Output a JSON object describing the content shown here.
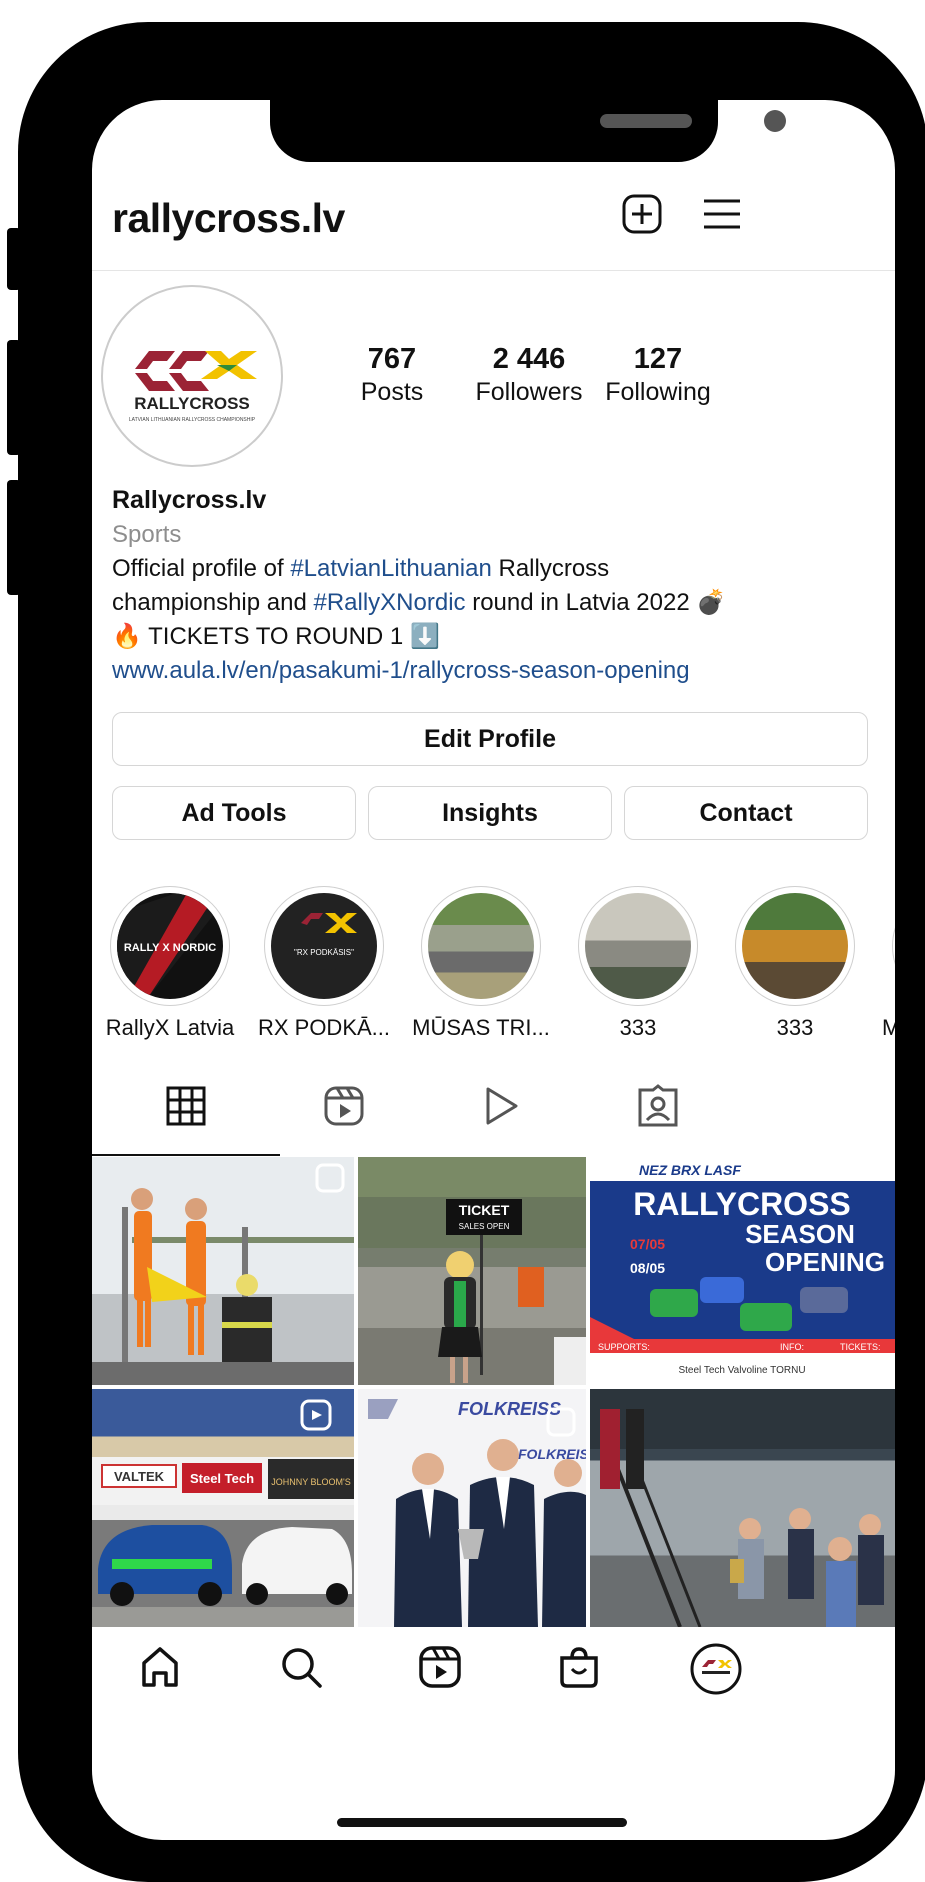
{
  "header": {
    "username": "rallycross.lv",
    "add_icon": "plus-square-icon",
    "menu_icon": "hamburger-icon"
  },
  "avatar": {
    "logo_text": "RALLYCROSS",
    "logo_sub": "LATVIAN LITHUANIAN RALLYCROSS CHAMPIONSHIP"
  },
  "stats": [
    {
      "value": "767",
      "label": "Posts"
    },
    {
      "value": "2 446",
      "label": "Followers"
    },
    {
      "value": "127",
      "label": "Following"
    }
  ],
  "bio": {
    "name": "Rallycross.lv",
    "category": "Sports",
    "line1_pre": "Official profile of ",
    "line1_tag": "#LatvianLithuanian",
    "line1_post": " Rallycross",
    "line2_pre": "championship and ",
    "line2_tag": "#RallyXNordic",
    "line2_post": " round in Latvia 2022 💣",
    "line3": "🔥 TICKETS TO ROUND 1 ⬇️",
    "link": "www.aula.lv/en/pasakumi-1/rallycross-season-opening"
  },
  "buttons": {
    "edit_profile": "Edit Profile",
    "ad_tools": "Ad Tools",
    "insights": "Insights",
    "contact": "Contact"
  },
  "highlights": [
    {
      "label": "RallyX Latvia",
      "cover_text": "RALLY X NORDIC"
    },
    {
      "label": "RX PODKĀ...",
      "cover_text": "\"RX PODKĀSIS\""
    },
    {
      "label": "MŪSAS TRI...",
      "cover_text": ""
    },
    {
      "label": "333",
      "cover_text": ""
    },
    {
      "label": "333",
      "cover_text": ""
    },
    {
      "label": "M",
      "cover_text": ""
    }
  ],
  "tabs": [
    {
      "icon": "grid-icon",
      "active": true
    },
    {
      "icon": "reels-icon",
      "active": false
    },
    {
      "icon": "play-icon",
      "active": false
    },
    {
      "icon": "tagged-person-icon",
      "active": false
    }
  ],
  "posts": {
    "p2_sign_title": "TICKET",
    "p2_sign_sub": "SALES OPEN",
    "p3_brands": "NEZ BRX LASF",
    "p3_title1": "RALLYCROSS",
    "p3_title2": "SEASON",
    "p3_title3": "OPENING",
    "p3_date1": "07/05",
    "p3_date2": "08/05",
    "p3_supports": "SUPPORTS:",
    "p3_info": "INFO:",
    "p3_tickets": "TICKETS:",
    "p3_sponsors": "Steel Tech  Valvoline  TORNU",
    "p4_banner1": "VALTEK",
    "p4_banner2": "Steel Tech",
    "p4_banner3": "JOHNNY BLOOM'S",
    "p5_banner": "FOLKREISS"
  },
  "bottom_nav": [
    "home-icon",
    "search-icon",
    "reels-icon",
    "shop-icon",
    "profile-avatar-icon"
  ],
  "colors": {
    "link": "#1f4e8c",
    "muted": "#8e8e8e",
    "border": "#d6d6d6"
  }
}
